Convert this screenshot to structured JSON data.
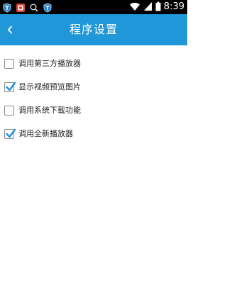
{
  "status_bar": {
    "time": "8:39",
    "left_icons": [
      "shield-app-icon",
      "photo-app-icon",
      "search-icon",
      "shield-app-icon"
    ],
    "right_icons": [
      "wifi-icon",
      "signal-icon",
      "battery-icon"
    ]
  },
  "header": {
    "title": "程序设置",
    "back_icon": "chevron-left-icon",
    "color": "#1f97d8"
  },
  "settings": {
    "items": [
      {
        "label": "调用第三方播放器",
        "checked": false
      },
      {
        "label": "显示视频预览图片",
        "checked": true
      },
      {
        "label": "调用系统下载功能",
        "checked": false
      },
      {
        "label": "调用全新播放器",
        "checked": true
      }
    ],
    "check_color": "#1f97d8"
  }
}
